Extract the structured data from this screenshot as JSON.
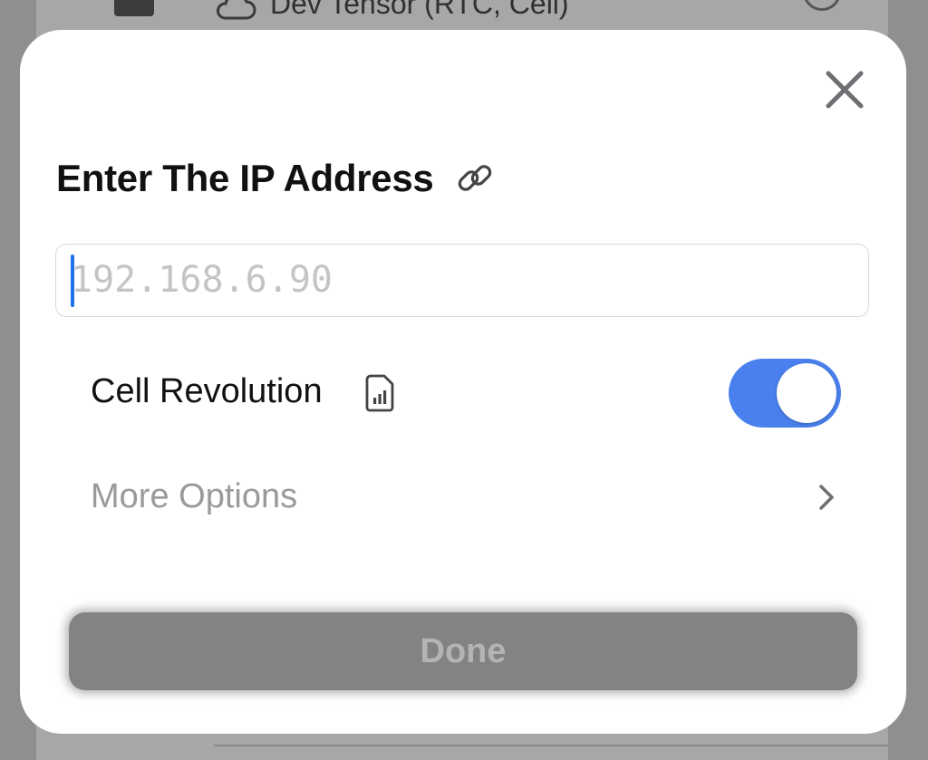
{
  "background": {
    "row_title": "Dev Tensor (RTC, Cell)",
    "cloud_icon": "cloud-icon",
    "info_icon": "info-icon"
  },
  "modal": {
    "close_icon": "close-icon",
    "title": "Enter The IP Address",
    "title_icon": "link-icon",
    "ip_field": {
      "placeholder": "192.168.6.90",
      "value": ""
    },
    "cell_revolution": {
      "label": "Cell Revolution",
      "icon": "sim-card-icon",
      "enabled": true,
      "toggle_color": "#4a80ed"
    },
    "more_options": {
      "label": "More Options",
      "icon": "chevron-right-icon"
    },
    "done_button": {
      "label": "Done",
      "disabled": true
    }
  }
}
